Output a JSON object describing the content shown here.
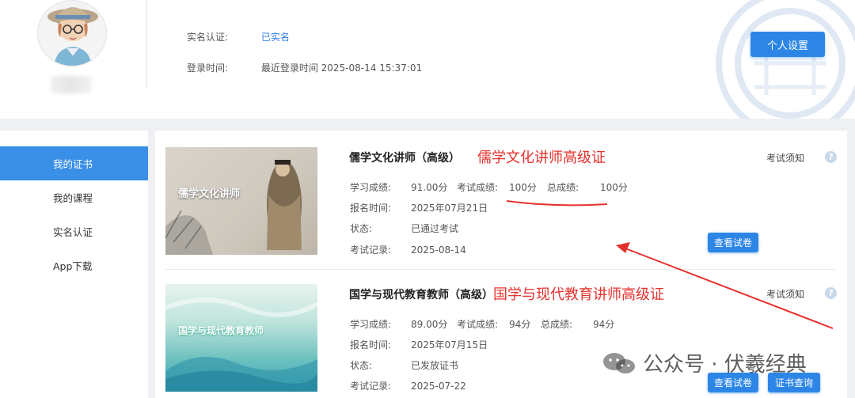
{
  "profile": {
    "realname_label": "实名认证:",
    "realname_value": "已实名",
    "login_label": "登录时间:",
    "login_value": "最近登录时间 2025-08-14 15:37:01",
    "settings_button": "个人设置"
  },
  "sidebar": {
    "items": [
      {
        "label": "我的证书",
        "active": true
      },
      {
        "label": "我的课程",
        "active": false
      },
      {
        "label": "实名认证",
        "active": false
      },
      {
        "label": "App下载",
        "active": false
      }
    ]
  },
  "certificates": [
    {
      "title": "儒学文化讲师（高级）",
      "annotation": "儒学文化讲师高级证",
      "image_text": "儒学文化讲师",
      "study_score_label": "学习成绩:",
      "study_score": "91.00分",
      "exam_score_label": "考试成绩:",
      "exam_score": "100分",
      "total_score_label": "总成绩:",
      "total_score": "100分",
      "signup_label": "报名时间:",
      "signup_value": "2025年07月21日",
      "status_label": "状态:",
      "status_value": "已通过考试",
      "record_label": "考试记录:",
      "record_value": "2025-08-14",
      "notice": "考试须知",
      "help": "?",
      "view_paper_button": "查看试卷"
    },
    {
      "title": "国学与现代教育教师（高级）",
      "annotation": "国学与现代教育讲师高级证",
      "image_text": "国学与现代教育教师",
      "study_score_label": "学习成绩:",
      "study_score": "89.00分",
      "exam_score_label": "考试成绩:",
      "exam_score": "94分",
      "total_score_label": "总成绩:",
      "total_score": "94分",
      "signup_label": "报名时间:",
      "signup_value": "2025年07月15日",
      "status_label": "状态:",
      "status_value": "已发放证书",
      "record_label": "考试记录:",
      "record_value": "2025-07-22",
      "notice": "考试须知",
      "help": "?",
      "view_paper_button": "查看试卷",
      "cert_query_button": "证书查询"
    }
  ],
  "watermark": "公众号 · 伏羲经典",
  "colors": {
    "primary": "#2d86e6",
    "annotation": "#e5322d",
    "sidebar_active": "#3a8fe6"
  }
}
